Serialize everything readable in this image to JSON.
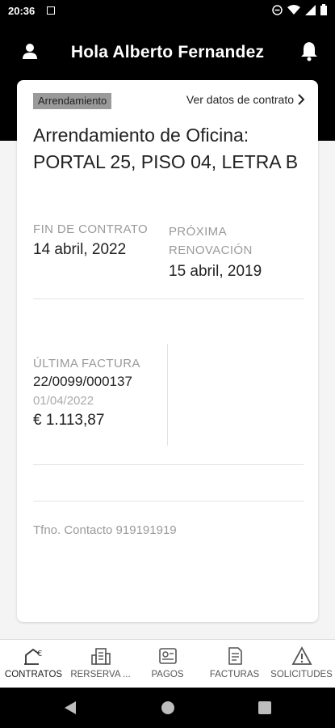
{
  "status_bar": {
    "time": "20:36",
    "icons": [
      "notification-square-icon",
      "do-not-disturb-icon",
      "wifi-icon",
      "signal-icon",
      "battery-icon"
    ]
  },
  "header": {
    "greeting": "Hola Alberto Fernandez",
    "left_icon": "profile-icon",
    "right_icon": "bell-icon"
  },
  "card": {
    "tag": "Arrendamiento",
    "link_label": "Ver datos de contrato",
    "title": "Arrendamiento de Oficina: PORTAL 25, PISO 04, LETRA B",
    "fin_label": "FIN DE CONTRATO",
    "fin_value": "14 abril, 2022",
    "renov_label": "PRÓXIMA RENOVACIÓN",
    "renov_value": "15 abril, 2019",
    "factura_label": "ÚLTIMA FACTURA",
    "factura_number": "22/0099/000137",
    "factura_date": "01/04/2022",
    "factura_amount": "€ 1.113,87",
    "contact": "Tfno. Contacto 919191919"
  },
  "bottom_nav": [
    {
      "label": "CONTRATOS",
      "icon": "house-euro-icon"
    },
    {
      "label": "RERSERVA ...",
      "icon": "building-icon"
    },
    {
      "label": "PAGOS",
      "icon": "wallet-icon"
    },
    {
      "label": "FACTURAS",
      "icon": "invoice-icon"
    },
    {
      "label": "SOLICITUDES",
      "icon": "warning-triangle-icon"
    }
  ],
  "colors": {
    "header_bg": "#000000",
    "card_bg": "#ffffff",
    "tag_bg": "#9a9a9a",
    "muted_text": "#9a9a9a"
  }
}
